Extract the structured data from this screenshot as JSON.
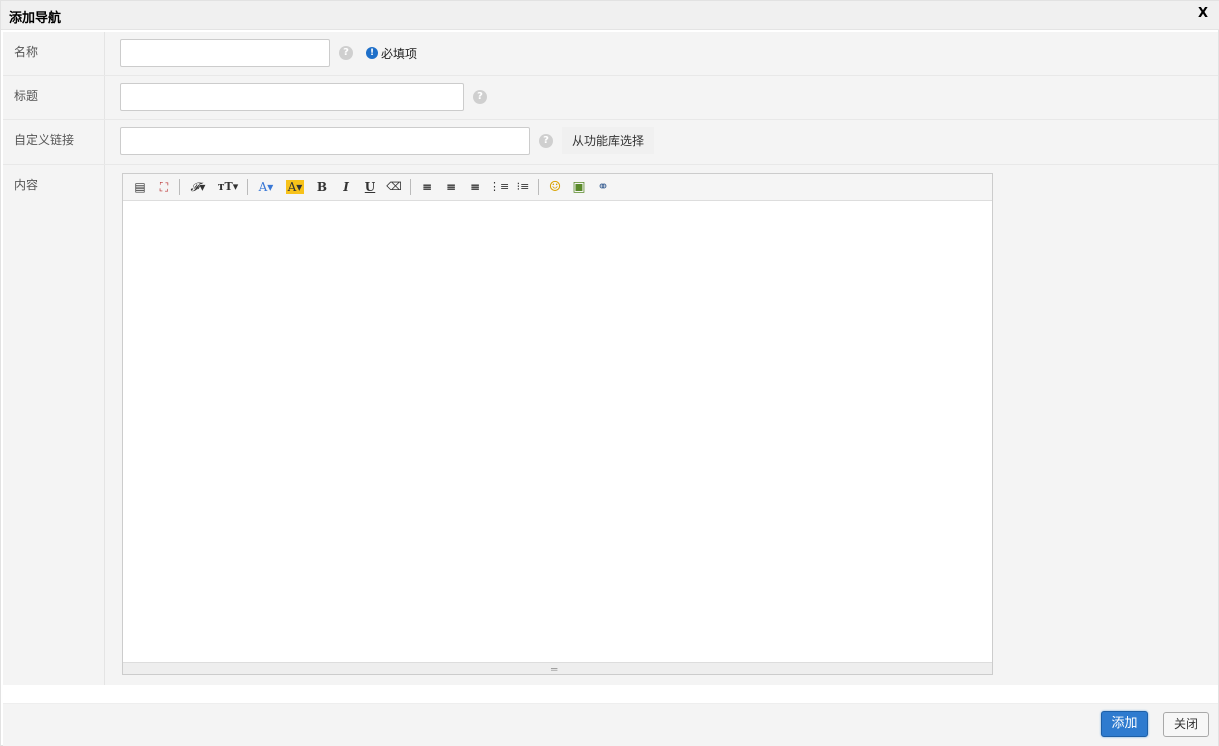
{
  "dialog": {
    "title": "添加导航",
    "close_label": "X"
  },
  "form": {
    "name": {
      "label": "名称",
      "value": "",
      "placeholder": "",
      "help": "?",
      "required_icon": "!",
      "required_text": "必填项"
    },
    "title": {
      "label": "标题",
      "value": "",
      "placeholder": "",
      "help": "?"
    },
    "custom_link": {
      "label": "自定义链接",
      "value": "",
      "placeholder": "",
      "help": "?",
      "library_link": "从功能库选择"
    },
    "content": {
      "label": "内容"
    }
  },
  "editor": {
    "toolbar": [
      {
        "name": "source-icon",
        "glyph": "▤"
      },
      {
        "name": "fullscreen-icon",
        "glyph": "⛶"
      },
      {
        "name": "font-family-icon",
        "glyph": "𝓕▾"
      },
      {
        "name": "font-size-icon",
        "glyph": "ᴛT▾"
      },
      {
        "name": "font-color-icon",
        "glyph": "A▾"
      },
      {
        "name": "highlight-color-icon",
        "glyph": "A▾"
      },
      {
        "name": "bold-icon",
        "glyph": "B"
      },
      {
        "name": "italic-icon",
        "glyph": "I"
      },
      {
        "name": "underline-icon",
        "glyph": "U"
      },
      {
        "name": "eraser-icon",
        "glyph": "⌫"
      },
      {
        "name": "align-left-icon",
        "glyph": "≡"
      },
      {
        "name": "align-center-icon",
        "glyph": "≡"
      },
      {
        "name": "align-right-icon",
        "glyph": "≡"
      },
      {
        "name": "ordered-list-icon",
        "glyph": "⋮≡"
      },
      {
        "name": "unordered-list-icon",
        "glyph": "⁝≡"
      },
      {
        "name": "emoticon-icon",
        "glyph": "☺"
      },
      {
        "name": "image-icon",
        "glyph": "▣"
      },
      {
        "name": "link-icon",
        "glyph": "⚭"
      }
    ],
    "colors": {
      "font_color": "#3a78d6",
      "highlight": "#f7c21a"
    }
  },
  "footer": {
    "add_label": "添加",
    "close_label": "关闭"
  },
  "colors": {
    "primary": "#2e7bcf",
    "required_icon": "#1e6fc9",
    "panel_bg": "#f4f4f4"
  }
}
